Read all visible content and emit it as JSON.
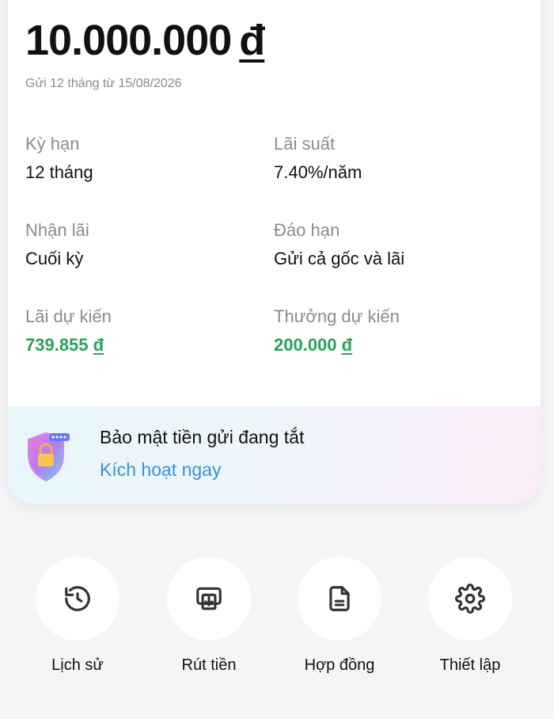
{
  "deposit": {
    "amount": "10.000.000",
    "currency": "đ",
    "subtitle": "Gửi 12 tháng từ 15/08/2026"
  },
  "details": [
    {
      "label": "Kỳ hạn",
      "value": "12 tháng"
    },
    {
      "label": "Lãi suất",
      "value": "7.40%/năm"
    },
    {
      "label": "Nhận lãi",
      "value": "Cuối kỳ"
    },
    {
      "label": "Đáo hạn",
      "value": "Gửi cả gốc và lãi"
    },
    {
      "label": "Lãi dự kiến",
      "value": "739.855",
      "currency": "đ"
    },
    {
      "label": "Thưởng dự kiến",
      "value": "200.000",
      "currency": "đ"
    }
  ],
  "security": {
    "title": "Bảo mật tiền gửi đang tắt",
    "link": "Kích hoạt ngay",
    "icon": "shield-lock-icon"
  },
  "actions": [
    {
      "label": "Lịch sử",
      "icon": "history-icon"
    },
    {
      "label": "Rút tiền",
      "icon": "withdraw-icon"
    },
    {
      "label": "Hợp đồng",
      "icon": "document-icon"
    },
    {
      "label": "Thiết lập",
      "icon": "gear-icon"
    }
  ],
  "colors": {
    "accent_green": "#27a35a",
    "link_blue": "#3a8fe0",
    "label_gray": "#8b8b90"
  }
}
